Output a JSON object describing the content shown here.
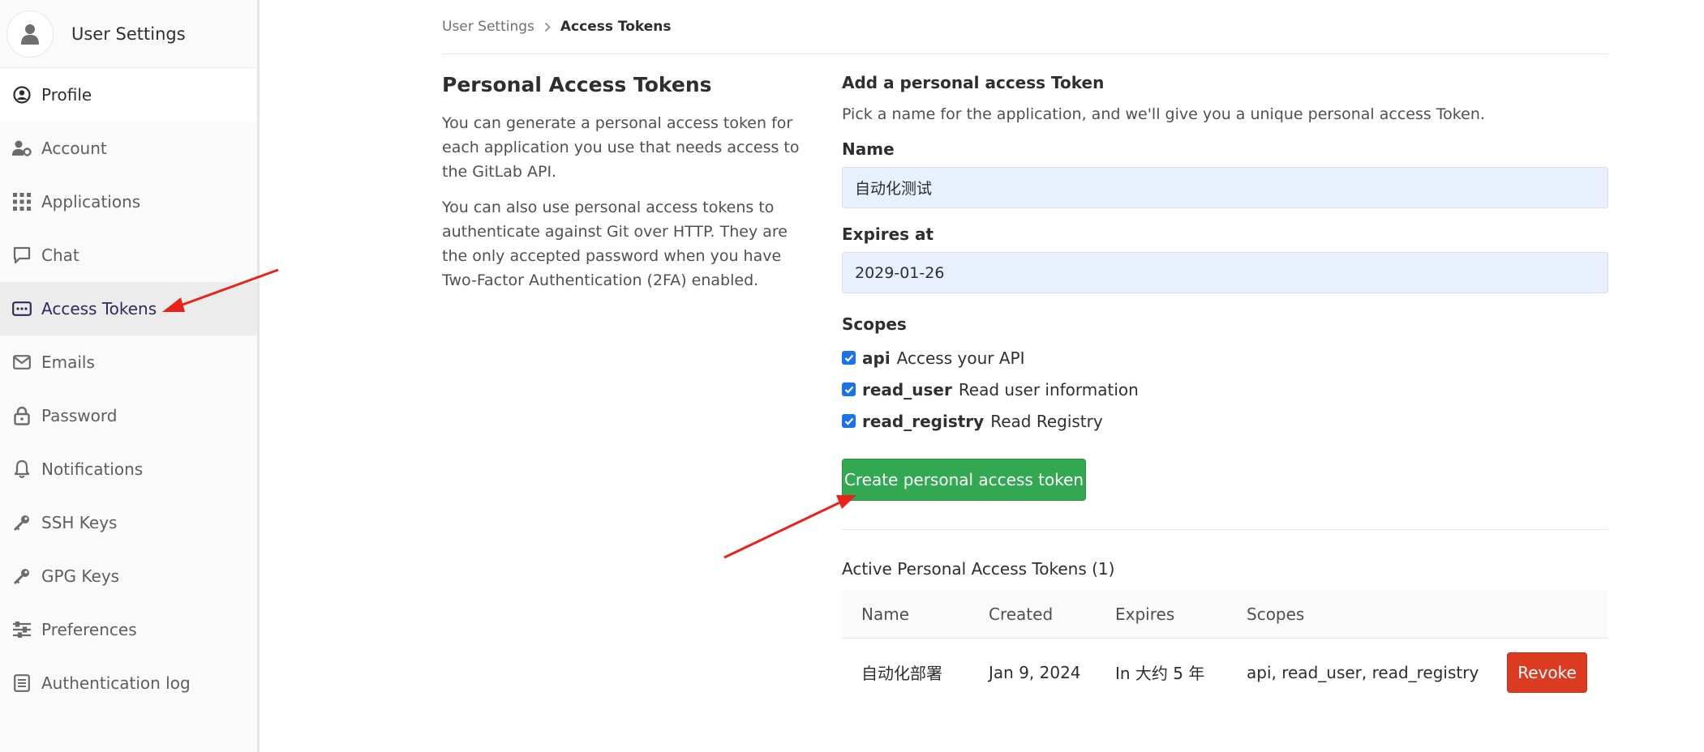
{
  "sidebar": {
    "title": "User Settings",
    "items": [
      {
        "label": "Profile",
        "icon": "profile-icon"
      },
      {
        "label": "Account",
        "icon": "account-icon"
      },
      {
        "label": "Applications",
        "icon": "applications-icon"
      },
      {
        "label": "Chat",
        "icon": "chat-icon"
      },
      {
        "label": "Access Tokens",
        "icon": "token-icon"
      },
      {
        "label": "Emails",
        "icon": "envelope-icon"
      },
      {
        "label": "Password",
        "icon": "lock-icon"
      },
      {
        "label": "Notifications",
        "icon": "bell-icon"
      },
      {
        "label": "SSH Keys",
        "icon": "key-icon"
      },
      {
        "label": "GPG Keys",
        "icon": "key-icon"
      },
      {
        "label": "Preferences",
        "icon": "sliders-icon"
      },
      {
        "label": "Authentication log",
        "icon": "log-icon"
      }
    ]
  },
  "breadcrumb": {
    "parent": "User Settings",
    "current": "Access Tokens"
  },
  "intro": {
    "title": "Personal Access Tokens",
    "paragraph1": "You can generate a personal access token for each application you use that needs access to the GitLab API.",
    "paragraph2": "You can also use personal access tokens to authenticate against Git over HTTP. They are the only accepted password when you have Two-Factor Authentication (2FA) enabled."
  },
  "form": {
    "heading": "Add a personal access Token",
    "hint": "Pick a name for the application, and we'll give you a unique personal access Token.",
    "name_label": "Name",
    "name_value": "自动化测试",
    "expires_label": "Expires at",
    "expires_value": "2029-01-26",
    "scopes_label": "Scopes",
    "scopes": [
      {
        "name": "api",
        "description": "Access your API",
        "checked": true
      },
      {
        "name": "read_user",
        "description": "Read user information",
        "checked": true
      },
      {
        "name": "read_registry",
        "description": "Read Registry",
        "checked": true
      }
    ],
    "create_button": "Create personal access token"
  },
  "active_tokens": {
    "title": "Active Personal Access Tokens (1)",
    "columns": [
      "Name",
      "Created",
      "Expires",
      "Scopes"
    ],
    "rows": [
      {
        "name": "自动化部署",
        "created": "Jan 9, 2024",
        "expires": "In 大约 5 年",
        "scopes": "api, read_user, read_registry",
        "action": "Revoke"
      }
    ]
  },
  "colors": {
    "create_button": "#32a852",
    "revoke_button": "#db3b21",
    "input_bg": "#e8f0fe",
    "annotation_arrow": "#e8231a"
  }
}
